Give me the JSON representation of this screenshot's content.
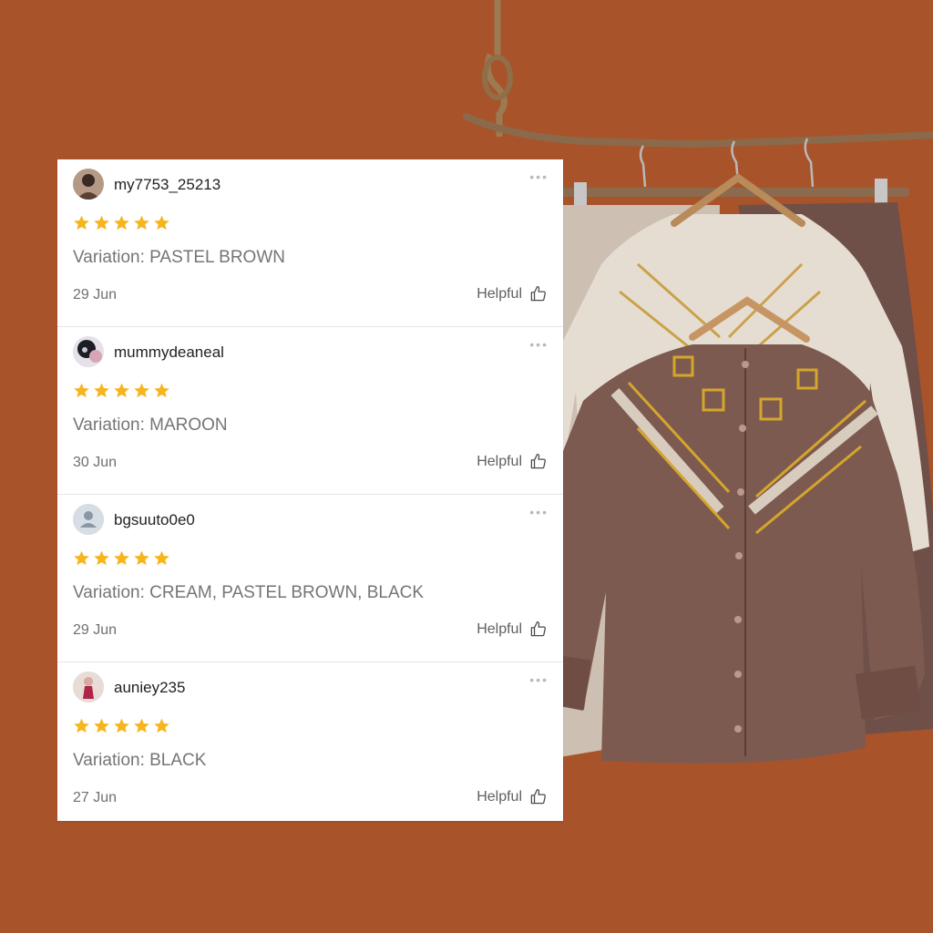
{
  "reviews": [
    {
      "username": "my7753_25213",
      "avatar": "user-photo-avatar",
      "rating": 5,
      "variation": "Variation: PASTEL BROWN",
      "date": "29 Jun",
      "helpful_label": "Helpful",
      "more_icon": "more-options-icon"
    },
    {
      "username": "mummydeaneal",
      "avatar": "user-photo-avatar",
      "rating": 5,
      "variation": "Variation: MAROON",
      "date": "30 Jun",
      "helpful_label": "Helpful",
      "more_icon": "more-options-icon"
    },
    {
      "username": "bgsuuto0e0",
      "avatar": "default-person-avatar",
      "rating": 5,
      "variation": "Variation: CREAM, PASTEL BROWN, BLACK",
      "date": "29 Jun",
      "helpful_label": "Helpful",
      "more_icon": "more-options-icon"
    },
    {
      "username": "auniey235",
      "avatar": "user-photo-avatar",
      "rating": 5,
      "variation": "Variation: BLACK",
      "date": "27 Jun",
      "helpful_label": "Helpful",
      "more_icon": "more-options-icon"
    }
  ],
  "icons": {
    "star": "star-icon",
    "helpful": "thumbs-up-icon"
  },
  "colors": {
    "background": "#a9532a",
    "star": "#f6b51e",
    "card": "#ffffff"
  }
}
